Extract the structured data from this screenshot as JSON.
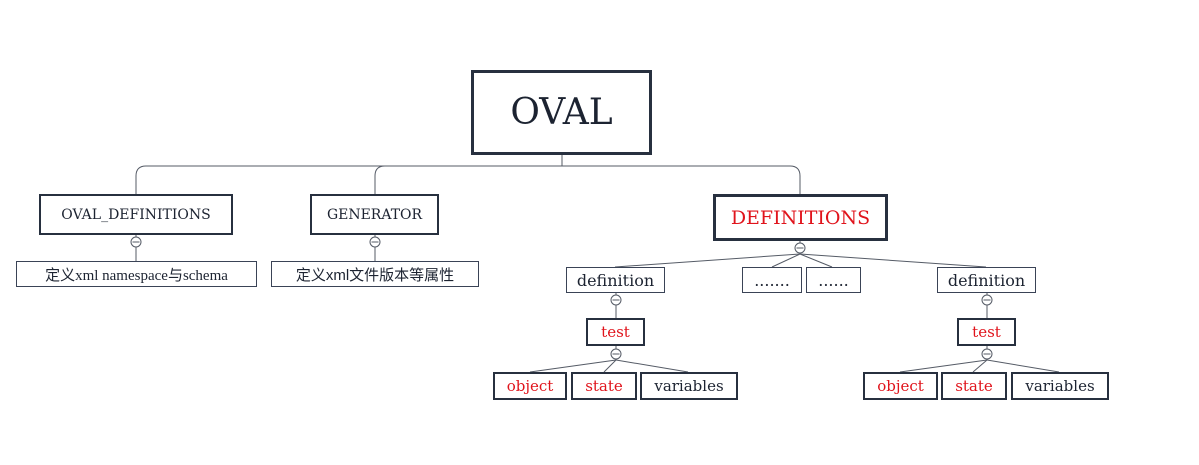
{
  "root": {
    "label": "OVAL"
  },
  "oval_definitions": {
    "label": "OVAL_DEFINITIONS",
    "note": "定义xml namespace与schema"
  },
  "generator": {
    "label": "GENERATOR",
    "note": "定义xml文件版本等属性"
  },
  "definitions": {
    "label": "DEFINITIONS"
  },
  "definitions_children": {
    "definition_left": "definition",
    "ellipsis_1": ".......",
    "ellipsis_2": "......",
    "definition_right": "definition"
  },
  "left_branch": {
    "test": "test",
    "object": "object",
    "state": "state",
    "variables": "variables"
  },
  "right_branch": {
    "test": "test",
    "object": "object",
    "state": "state",
    "variables": "variables"
  },
  "colors": {
    "emphasis": "#e0141c",
    "ink": "#1c2331",
    "border": "#27303f"
  }
}
